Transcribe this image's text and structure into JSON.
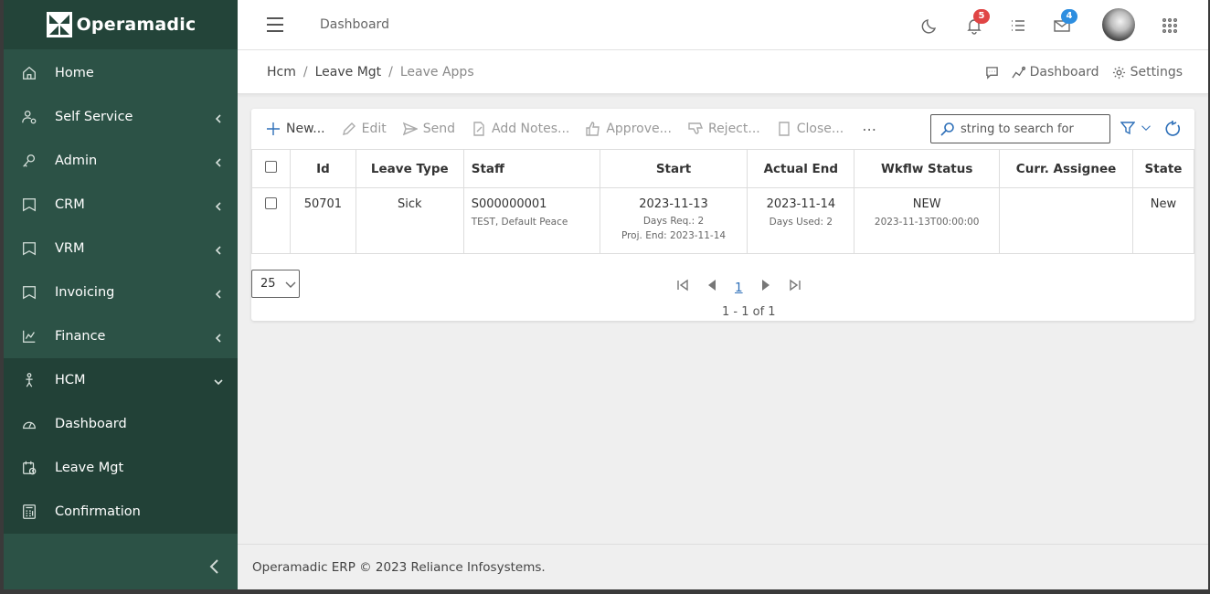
{
  "brand": {
    "name": "Operamadic"
  },
  "sidebar": {
    "items": [
      {
        "label": "Home",
        "icon": "home-icon",
        "chevron": false
      },
      {
        "label": "Self Service",
        "icon": "user-gear-icon",
        "chevron": true
      },
      {
        "label": "Admin",
        "icon": "key-icon",
        "chevron": true
      },
      {
        "label": "CRM",
        "icon": "id-card-icon",
        "chevron": true
      },
      {
        "label": "VRM",
        "icon": "id-card-icon",
        "chevron": true
      },
      {
        "label": "Invoicing",
        "icon": "id-card-icon",
        "chevron": true
      },
      {
        "label": "Finance",
        "icon": "chart-icon",
        "chevron": true
      },
      {
        "label": "HCM",
        "icon": "person-icon",
        "chevron": true,
        "open": true
      },
      {
        "label": "Dashboard",
        "icon": "gauge-icon",
        "chevron": false
      },
      {
        "label": "Leave Mgt",
        "icon": "calendar-clock-icon",
        "chevron": false
      },
      {
        "label": "Confirmation",
        "icon": "calculator-icon",
        "chevron": false
      }
    ]
  },
  "topbar": {
    "title": "Dashboard",
    "notifications_count": "5",
    "messages_count": "4"
  },
  "breadcrumb": {
    "items": [
      "Hcm",
      "Leave Mgt"
    ],
    "current": "Leave Apps"
  },
  "subactions": {
    "dashboard": "Dashboard",
    "settings": "Settings"
  },
  "toolbar": {
    "new": "New...",
    "edit": "Edit",
    "send": "Send",
    "add_notes": "Add Notes...",
    "approve": "Approve...",
    "reject": "Reject...",
    "close": "Close...",
    "more": "⋯"
  },
  "search": {
    "placeholder": "string to search for"
  },
  "table": {
    "columns": [
      "Id",
      "Leave Type",
      "Staff",
      "Start",
      "Actual End",
      "Wkflw Status",
      "Curr. Assignee",
      "State"
    ],
    "rows": [
      {
        "id": "50701",
        "leave_type": "Sick",
        "staff_code": "S000000001",
        "staff_name": "TEST, Default Peace",
        "start": "2023-11-13",
        "days_req": "Days Req.: 2",
        "proj_end": "Proj. End: 2023-11-14",
        "actual_end": "2023-11-14",
        "days_used": "Days Used: 2",
        "wkflw_status": "NEW",
        "wkflw_date": "2023-11-13T00:00:00",
        "curr_assignee": "",
        "state": "New"
      }
    ]
  },
  "pager": {
    "page_size": "25",
    "current_page": "1",
    "info": "1 - 1 of 1"
  },
  "footer": {
    "text": "Operamadic ERP © 2023 Reliance Infosystems."
  }
}
